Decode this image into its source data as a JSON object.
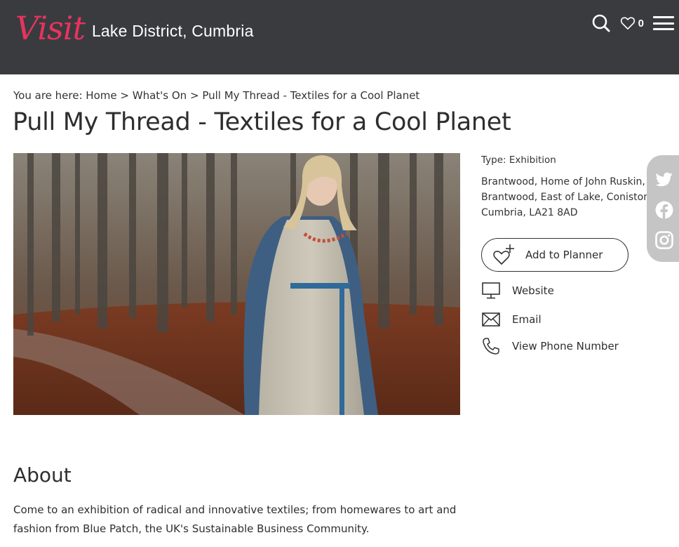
{
  "header": {
    "logo_script": "Visit",
    "logo_region": "Lake District, Cumbria",
    "favourites_count": "0",
    "brand_color": "#e7335f",
    "bg_color": "#3a3b3f"
  },
  "breadcrumb": {
    "prefix": "You are here:",
    "items": [
      "Home",
      "What's On",
      "Pull My Thread - Textiles for a Cool Planet"
    ],
    "separator": ">"
  },
  "page_title": "Pull My Thread - Textiles for a Cool Planet",
  "details": {
    "type_label": "Type: Exhibition",
    "address_lines": [
      "Brantwood, Home of John Ruskin,",
      "Brantwood, East of Lake, Coniston,",
      "Cumbria, LA21 8AD"
    ],
    "planner_label": "Add to Planner",
    "website_label": "Website",
    "email_label": "Email",
    "phone_label": "View Phone Number"
  },
  "social": {
    "icons": [
      "twitter-icon",
      "facebook-icon",
      "instagram-icon"
    ]
  },
  "about": {
    "heading": "About",
    "text": "Come to an exhibition of radical and innovative textiles; from homewares to art and fashion from Blue Patch, the UK's Sustainable Business Community."
  }
}
